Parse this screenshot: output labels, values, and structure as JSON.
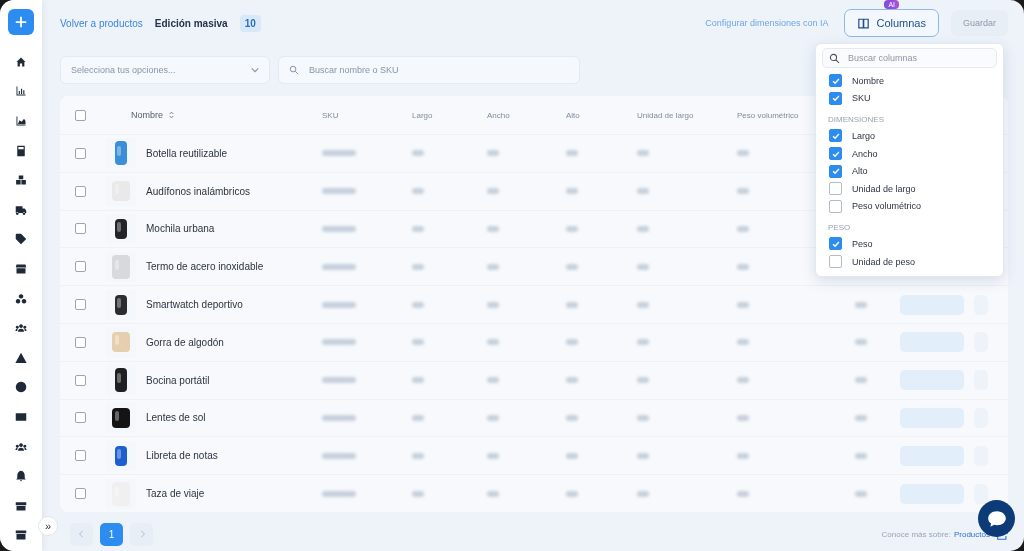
{
  "header": {
    "back_link": "Volver a productos",
    "title": "Edición masiva",
    "count": "10",
    "ai_link": "Configurar dimensiones con IA",
    "columns_button": "Columnas",
    "ai_badge": "AI",
    "save_button": "Guardar"
  },
  "filters": {
    "select_placeholder": "Selecciona tus opciones...",
    "search_placeholder": "Buscar nombre o SKU"
  },
  "table": {
    "select_all_checked": false,
    "columns": [
      {
        "label": "Nombre"
      },
      {
        "label": "SKU"
      },
      {
        "label": "Largo"
      },
      {
        "label": "Ancho"
      },
      {
        "label": "Alto"
      },
      {
        "label": "Unidad de largo"
      },
      {
        "label": "Peso volumétrico"
      }
    ],
    "rows": [
      {
        "name": "Botella reutilizable",
        "checked": false
      },
      {
        "name": "Audífonos inalámbricos",
        "checked": false
      },
      {
        "name": "Mochila urbana",
        "checked": false
      },
      {
        "name": "Termo de acero inoxidable",
        "checked": false
      },
      {
        "name": "Smartwatch deportivo",
        "checked": false
      },
      {
        "name": "Gorra de algodón",
        "checked": false
      },
      {
        "name": "Bocina portátil",
        "checked": false
      },
      {
        "name": "Lentes de sol",
        "checked": false
      },
      {
        "name": "Libreta de notas",
        "checked": false
      },
      {
        "name": "Taza de viaje",
        "checked": false
      }
    ]
  },
  "pagination": {
    "pages": [
      {
        "label": "1",
        "selected": true
      }
    ]
  },
  "footer": {
    "text": "Conoce más sobre:",
    "link": "Productos"
  },
  "sidebar": {
    "expand_button": "»"
  },
  "columns_menu": {
    "search_placeholder": "Buscar columnas",
    "items": [
      {
        "kind": "option",
        "label": "Nombre",
        "checked": true
      },
      {
        "kind": "option",
        "label": "SKU",
        "checked": true
      },
      {
        "kind": "heading",
        "label": "DIMENSIONES"
      },
      {
        "kind": "option",
        "label": "Largo",
        "checked": true
      },
      {
        "kind": "option",
        "label": "Ancho",
        "checked": true
      },
      {
        "kind": "option",
        "label": "Alto",
        "checked": true
      },
      {
        "kind": "option",
        "label": "Unidad de largo",
        "checked": false
      },
      {
        "kind": "option",
        "label": "Peso volumétrico",
        "checked": false
      },
      {
        "kind": "heading",
        "label": "PESO"
      },
      {
        "kind": "option",
        "label": "Peso",
        "checked": true
      },
      {
        "kind": "option",
        "label": "Unidad de peso",
        "checked": false
      }
    ]
  }
}
